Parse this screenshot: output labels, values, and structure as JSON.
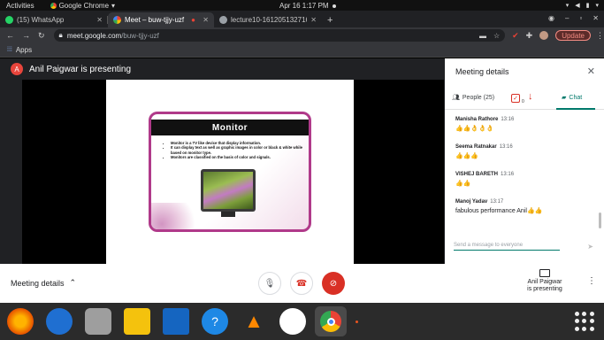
{
  "system": {
    "activities": "Activities",
    "app_name": "Google Chrome",
    "clock": "Apr 16  1:17 PM"
  },
  "tabs": [
    {
      "label": "(15) WhatsApp",
      "favicon_color": "#25d366"
    },
    {
      "label": "Meet – buw-tjjy-uzf",
      "favicon_color": "#4285f4"
    },
    {
      "label": "lecture10-1612051327162...",
      "favicon_color": "#9aa0a6"
    }
  ],
  "address": {
    "host": "meet.google.com",
    "path": "/buw-tjjy-uzf",
    "update_label": "Update"
  },
  "bookmarks": {
    "apps_label": "Apps"
  },
  "meet": {
    "presenter_initial": "A",
    "presenter_text": "Anil Paigwar is presenting"
  },
  "slide": {
    "title": "Monitor",
    "bullets": [
      "Monitor is a TV like device that display information.",
      "It can display text as well as graphic images in color or black & white while based on monitor type.",
      "Monitors are classified on the basis of color and signals."
    ]
  },
  "controls": {
    "meeting_details_label": "Meeting details",
    "presenter_label_line1": "Anil Paigwar",
    "presenter_label_line2": "is presenting"
  },
  "panel": {
    "title": "Meeting details",
    "people_label": "People (25)",
    "chat_label": "Chat",
    "badge_count": "0",
    "messages": [
      {
        "sender": "Manisha Rathore",
        "time": "13:16",
        "text": "👍👍👌👌👌"
      },
      {
        "sender": "Seema Ratnakar",
        "time": "13:16",
        "text": "👍👍👍"
      },
      {
        "sender": "VISHEJ BARETH",
        "time": "13:16",
        "text": "👍👍"
      },
      {
        "sender": "Manoj Yadav",
        "time": "13:17",
        "text": "fabulous performance Anil👍👍"
      }
    ],
    "input_placeholder": "Send a message to everyone"
  },
  "colors": {
    "accent_green": "#00796b",
    "danger_red": "#d93025",
    "slide_border": "#b03a8a"
  },
  "dock_icons": [
    "firefox-icon",
    "thunderbird-icon",
    "files-icon",
    "rhythmbox-icon",
    "writer-icon",
    "help-icon",
    "vlc-icon",
    "software-icon",
    "chrome-icon"
  ]
}
